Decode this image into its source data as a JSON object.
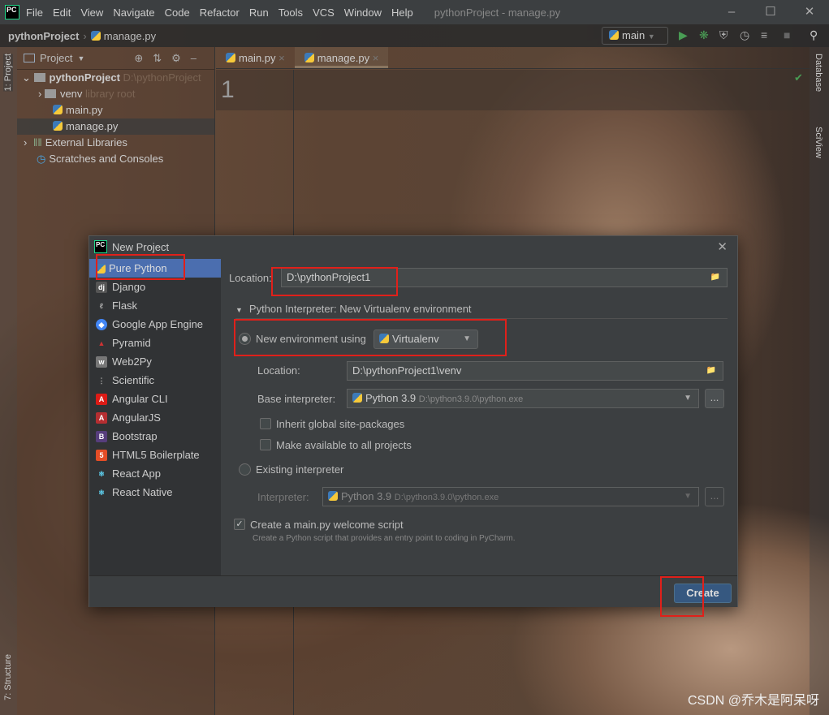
{
  "menubar": {
    "logo": "PC",
    "items": [
      "File",
      "Edit",
      "View",
      "Navigate",
      "Code",
      "Refactor",
      "Run",
      "Tools",
      "VCS",
      "Window",
      "Help"
    ],
    "window_title": "pythonProject - manage.py"
  },
  "navbar": {
    "project": "pythonProject",
    "file": "manage.py",
    "run_config": "main"
  },
  "left_strip": {
    "project": "1: Project",
    "structure": "7: Structure"
  },
  "right_strip": {
    "database": "Database",
    "sciview": "SciView"
  },
  "project_panel": {
    "title": "Project",
    "tree": [
      {
        "label": "pythonProject",
        "hint": "D:\\pythonProject"
      },
      {
        "label": "venv",
        "hint": "library root"
      },
      {
        "label": "main.py"
      },
      {
        "label": "manage.py"
      },
      {
        "label": "External Libraries"
      },
      {
        "label": "Scratches and Consoles"
      }
    ]
  },
  "editor": {
    "tabs": [
      "main.py",
      "manage.py"
    ],
    "line_number": "1"
  },
  "dialog": {
    "title": "New Project",
    "project_types": [
      "Pure Python",
      "Django",
      "Flask",
      "Google App Engine",
      "Pyramid",
      "Web2Py",
      "Scientific",
      "Angular CLI",
      "AngularJS",
      "Bootstrap",
      "HTML5 Boilerplate",
      "React App",
      "React Native"
    ],
    "location_label": "Location:",
    "location_value": "D:\\pythonProject1",
    "interpreter_section": "Python Interpreter: New Virtualenv environment",
    "new_env_label": "New environment using",
    "new_env_tool": "Virtualenv",
    "venv_location_label": "Location:",
    "venv_location_value": "D:\\pythonProject1\\venv",
    "base_interp_label": "Base interpreter:",
    "base_interp_name": "Python 3.9",
    "base_interp_path": "D:\\python3.9.0\\python.exe",
    "inherit_label": "Inherit global site-packages",
    "available_label": "Make available to all projects",
    "existing_label": "Existing interpreter",
    "interp_label": "Interpreter:",
    "interp_name": "Python 3.9",
    "interp_path": "D:\\python3.9.0\\python.exe",
    "welcome_label": "Create a main.py welcome script",
    "welcome_desc": "Create a Python script that provides an entry point to coding in PyCharm.",
    "browse": "...",
    "create": "Create"
  },
  "watermark": "CSDN @乔木是阿呆呀"
}
